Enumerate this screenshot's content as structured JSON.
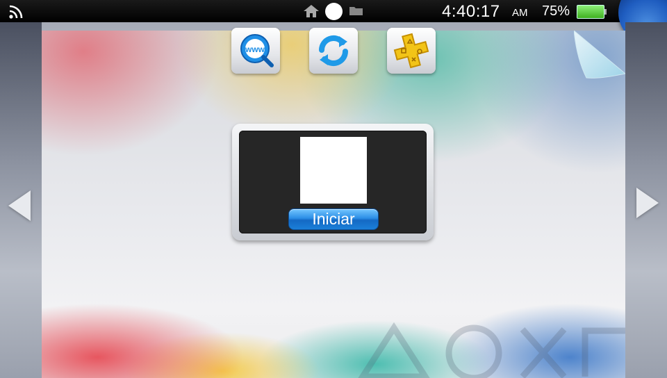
{
  "status_bar": {
    "time": "4:40:17",
    "ampm": "AM",
    "battery_percent": "75%",
    "battery_level": 0.75,
    "icons": [
      "wifi-icon",
      "home-icon",
      "notification-dot-icon",
      "folder-icon"
    ]
  },
  "live_area": {
    "start_label": "Iniciar"
  },
  "apps": [
    {
      "name": "browser",
      "icon": "www-search-icon"
    },
    {
      "name": "update",
      "icon": "refresh-icon"
    },
    {
      "name": "playstation-plus",
      "icon": "ps-plus-icon"
    }
  ],
  "colors": {
    "accent_blue": "#1f7fd6",
    "battery_green": "#5ad33a"
  }
}
